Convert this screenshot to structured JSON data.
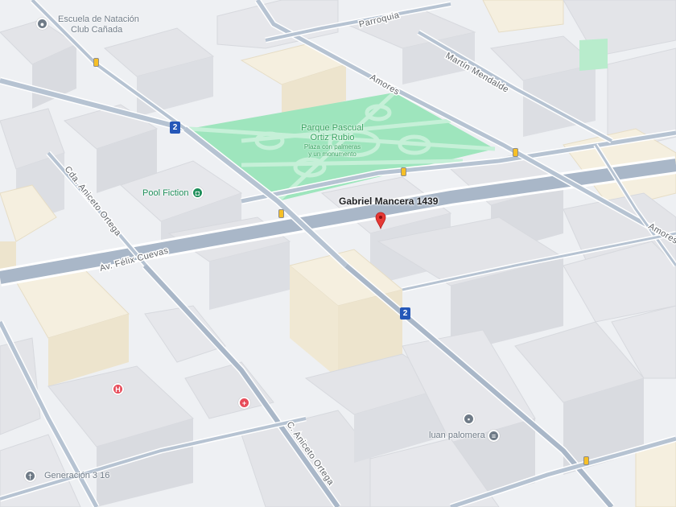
{
  "map": {
    "colors": {
      "road": "#a9b7c8",
      "road_edge": "#b6c3d2",
      "ground": "#eef0f3",
      "park": "#9ee5bd",
      "park_path": "#c6f0d8",
      "building_gray": "#e3e4e8",
      "building_cream": "#f5efdf",
      "park_text": "#34a15d",
      "hospital_red": "#e74c5a",
      "poi_gray": "#6f7b87",
      "poi_green": "#1e8e5a",
      "shield_blue": "#2557b8",
      "pin_red": "#e53935"
    },
    "streets": {
      "parroquia": "Parroquia",
      "martin_mendalde": "Martín Mendalde",
      "amores": "Amores",
      "amores_east": "Amores",
      "cda_aniceto_ortega": "Cda. Aniceto Ortega",
      "av_felix_cuevas": "Av. Félix Cuevas",
      "c_aniceto_ortega": "C. Aniceto Ortega"
    },
    "park": {
      "name_line1": "Parque Pascual",
      "name_line2": "Ortiz Rubio",
      "desc_line1": "Plaza con palmeras",
      "desc_line2": "y un monumento"
    },
    "selected_address": {
      "label": "Gabriel Mancera 1439",
      "pin_icon": "location-pin-icon"
    },
    "pois": {
      "escuela_line1": "Escuela de Natación",
      "escuela_line2": "Club Cañada",
      "escuela_icon": "map-marker-icon",
      "pool_fiction": "Pool Fiction",
      "pool_fiction_icon": "shopping-bag-icon",
      "luan_palomera": "luan palomera",
      "luan_palomera_icon": "store-icon",
      "generacion": "Generación 3 16",
      "generacion_icon": "church-icon",
      "hospital_icon_text": "H",
      "pharmacy_icon": "pharmacy-cross-icon"
    },
    "route_shields": {
      "shield_1": "2",
      "shield_2": "2"
    }
  }
}
